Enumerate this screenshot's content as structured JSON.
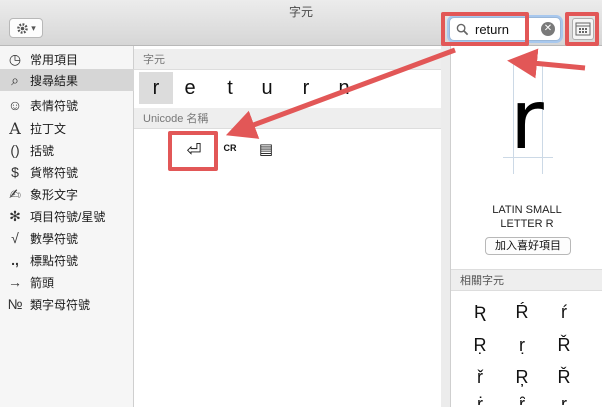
{
  "window": {
    "title": "字元"
  },
  "toolbar": {
    "gear_icon": "gear-icon",
    "gear_caret": "▾"
  },
  "search": {
    "value": "return",
    "placeholder": ""
  },
  "sidebar": {
    "items": [
      {
        "icon": "◷",
        "label": "常用項目"
      },
      {
        "icon": "⌕",
        "label": "搜尋結果"
      },
      {
        "icon": "☺",
        "label": "表情符號"
      },
      {
        "icon": "A",
        "label": "拉丁文"
      },
      {
        "icon": "()",
        "label": "括號"
      },
      {
        "icon": "$",
        "label": "貨幣符號"
      },
      {
        "icon": "✍",
        "label": "象形文字"
      },
      {
        "icon": "✻",
        "label": "項目符號/星號"
      },
      {
        "icon": "√",
        "label": "數學符號"
      },
      {
        "icon": ".,",
        "label": "標點符號"
      },
      {
        "icon": "→",
        "label": "箭頭"
      },
      {
        "icon": "№",
        "label": "類字母符號"
      }
    ]
  },
  "results": {
    "chars_header": "字元",
    "chars": [
      "r",
      "e",
      "t",
      "u",
      "r",
      "n"
    ],
    "unicode_header": "Unicode 名稱",
    "unicode_glyphs": [
      "⏎",
      "CR",
      "▤"
    ]
  },
  "detail": {
    "big_char": "r",
    "name_line1": "LATIN SMALL",
    "name_line2": "LETTER R",
    "fav_button": "加入喜好項目",
    "related_header": "相關字元",
    "related": [
      "Ʀ",
      "Ŕ",
      "ŕ",
      "Ṛ",
      "ṛ",
      "Ř",
      "ř",
      "Ŗ",
      "Ř",
      "ṙ",
      "ȓ",
      "ŗ"
    ]
  }
}
